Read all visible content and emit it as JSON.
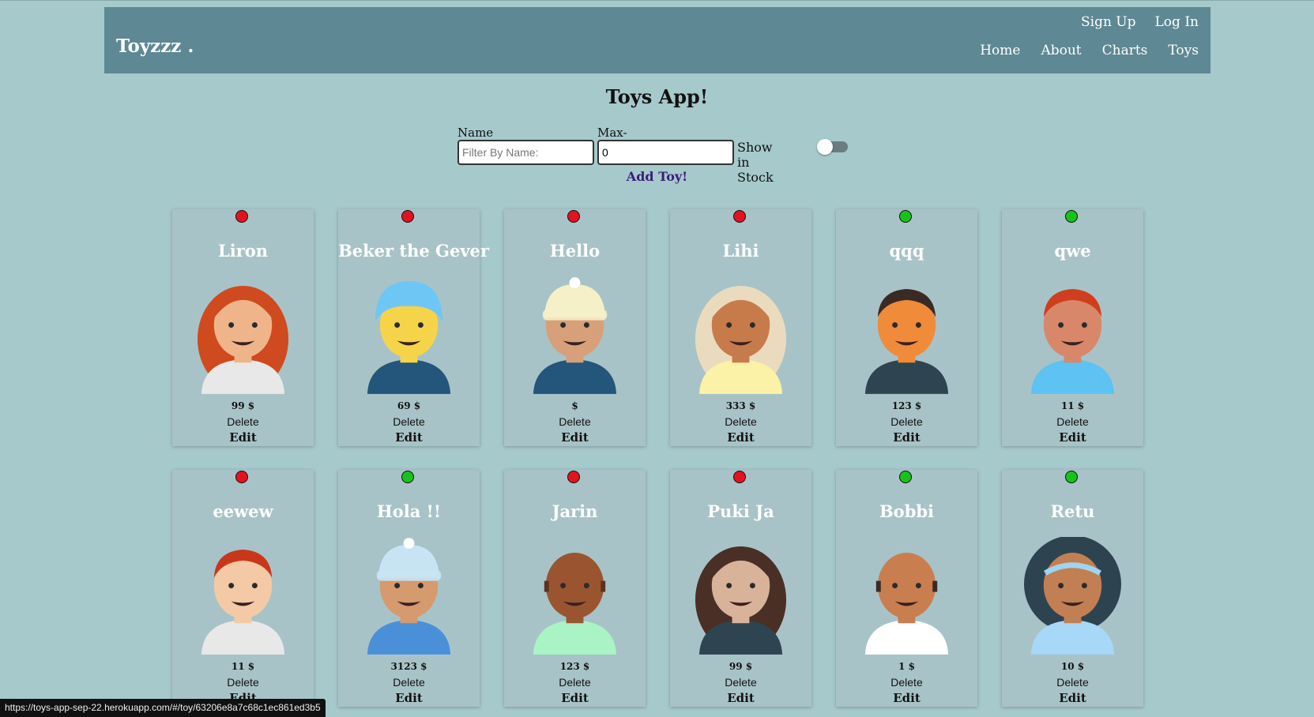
{
  "header": {
    "brand": "Toyzzz .",
    "auth": [
      "Sign Up",
      "Log In"
    ],
    "nav": [
      "Home",
      "About",
      "Charts",
      "Toys"
    ]
  },
  "page": {
    "title": "Toys App!",
    "add_toy_label": "Add Toy!"
  },
  "filters": {
    "name_label": "Name",
    "name_placeholder": "Filter By Name:",
    "name_value": "",
    "price_label": "Max-Price",
    "price_value": "0",
    "stock_label": "Show in Stock",
    "stock_toggle_on": false
  },
  "card_actions": {
    "delete_label": "Delete",
    "edit_label": "Edit"
  },
  "colors": {
    "in_stock": "#19c21b",
    "out_of_stock": "#e31221"
  },
  "toys": [
    {
      "name": "Liron",
      "price": "99 $",
      "in_stock": false,
      "avatar": {
        "hair": "#cf4a1e",
        "skin": "#f0b48a",
        "shirt": "#e8e8e8",
        "style": "long"
      }
    },
    {
      "name": "Beker the Gever",
      "price": "69 $",
      "in_stock": false,
      "avatar": {
        "hair": "#6ec6f5",
        "skin": "#f6d44a",
        "shirt": "#24557a",
        "style": "turban"
      }
    },
    {
      "name": "Hello",
      "price": "$",
      "in_stock": false,
      "avatar": {
        "hair": "#f6f0c8",
        "skin": "#d7a07a",
        "shirt": "#24557a",
        "style": "beanie"
      }
    },
    {
      "name": "Lihi",
      "price": "333 $",
      "in_stock": false,
      "avatar": {
        "hair": "#eadbbf",
        "skin": "#c77b4b",
        "shirt": "#fbf2a8",
        "style": "long"
      }
    },
    {
      "name": "qqq",
      "price": "123 $",
      "in_stock": true,
      "avatar": {
        "hair": "#3a2a26",
        "skin": "#f08b3a",
        "shirt": "#2f4451",
        "style": "short"
      }
    },
    {
      "name": "qwe",
      "price": "11 $",
      "in_stock": true,
      "avatar": {
        "hair": "#cf3e1e",
        "skin": "#d8876a",
        "shirt": "#5ec2f2",
        "style": "short"
      }
    },
    {
      "name": "eewew",
      "price": "11 $",
      "in_stock": false,
      "avatar": {
        "hair": "#c9371b",
        "skin": "#f3c9a6",
        "shirt": "#e8e8e8",
        "style": "short"
      }
    },
    {
      "name": "Hola !!",
      "price": "3123 $",
      "in_stock": true,
      "avatar": {
        "hair": "#c8e4f4",
        "skin": "#d59a6e",
        "shirt": "#4a90d9",
        "style": "beanie"
      }
    },
    {
      "name": "Jarin",
      "price": "123 $",
      "in_stock": false,
      "avatar": {
        "hair": "#5a3320",
        "skin": "#9a5530",
        "shirt": "#a9f3c5",
        "style": "bald"
      }
    },
    {
      "name": "Puki Ja",
      "price": "99 $",
      "in_stock": false,
      "avatar": {
        "hair": "#4a2f27",
        "skin": "#d9b29a",
        "shirt": "#2f4451",
        "style": "long"
      }
    },
    {
      "name": "Bobbi",
      "price": "1 $",
      "in_stock": true,
      "avatar": {
        "hair": "#3a2a26",
        "skin": "#c97e50",
        "shirt": "#ffffff",
        "style": "bald"
      }
    },
    {
      "name": "Retu",
      "price": "10 $",
      "in_stock": true,
      "avatar": {
        "hair": "#2e4350",
        "skin": "#c27f53",
        "shirt": "#a7d8f7",
        "style": "afro"
      }
    }
  ],
  "status_bar": "https://toys-app-sep-22.herokuapp.com/#/toy/63206e8a7c68c1ec861ed3b5"
}
